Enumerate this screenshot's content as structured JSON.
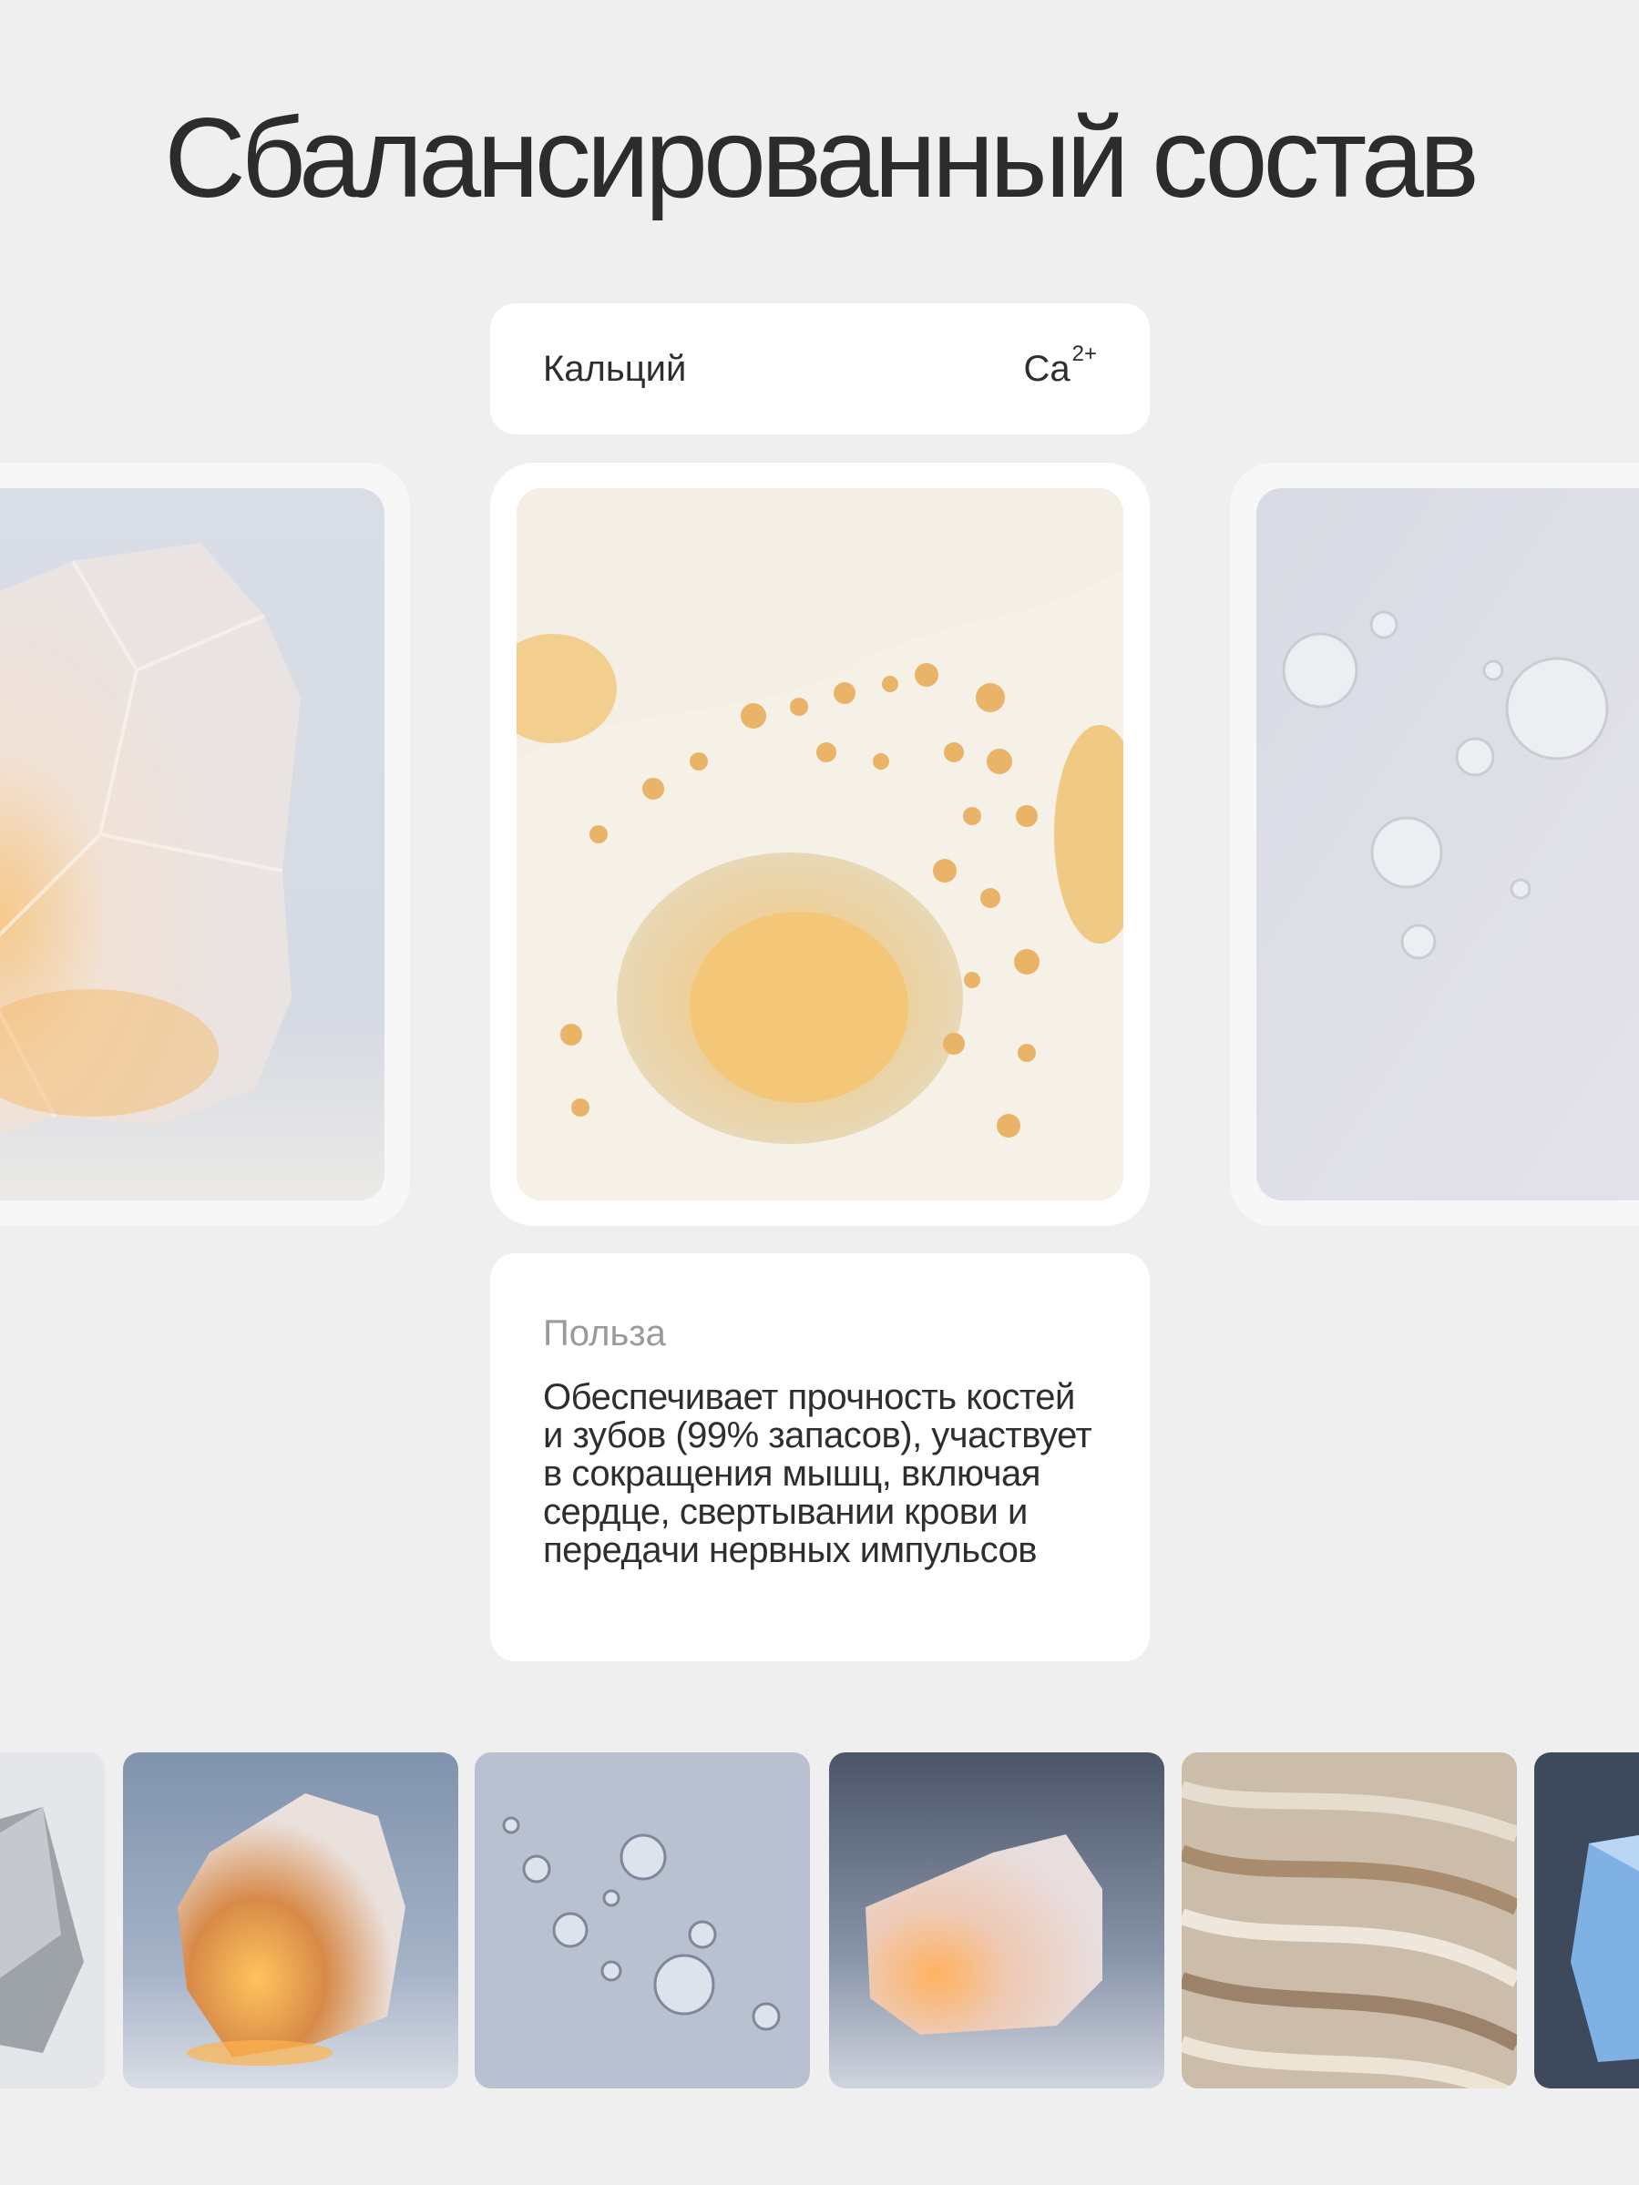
{
  "title": "Сбалансированный состав",
  "mineral": {
    "name": "Кальций",
    "symbol": "Ca",
    "charge": "2+"
  },
  "benefit": {
    "label": "Польза",
    "text": "Обеспечивает прочность костей и зубов (99% запасов), участвует в сокращения мышц, включая сердце, свертывании крови и передачи нервных импульсов"
  },
  "slides": [
    {
      "icon": "quartz-crystal-image"
    },
    {
      "icon": "porous-bone-image"
    },
    {
      "icon": "water-bubbles-image"
    }
  ],
  "thumbnails": [
    {
      "icon": "metal-rock-image"
    },
    {
      "icon": "amber-crystal-image"
    },
    {
      "icon": "bubbles-image"
    },
    {
      "icon": "salt-rock-image"
    },
    {
      "icon": "layered-stone-image"
    },
    {
      "icon": "blue-ice-crystal-image"
    }
  ],
  "colors": {
    "background": "#efefef",
    "card": "#ffffff",
    "text": "#2c2c2c",
    "muted": "#9a9a9a"
  }
}
